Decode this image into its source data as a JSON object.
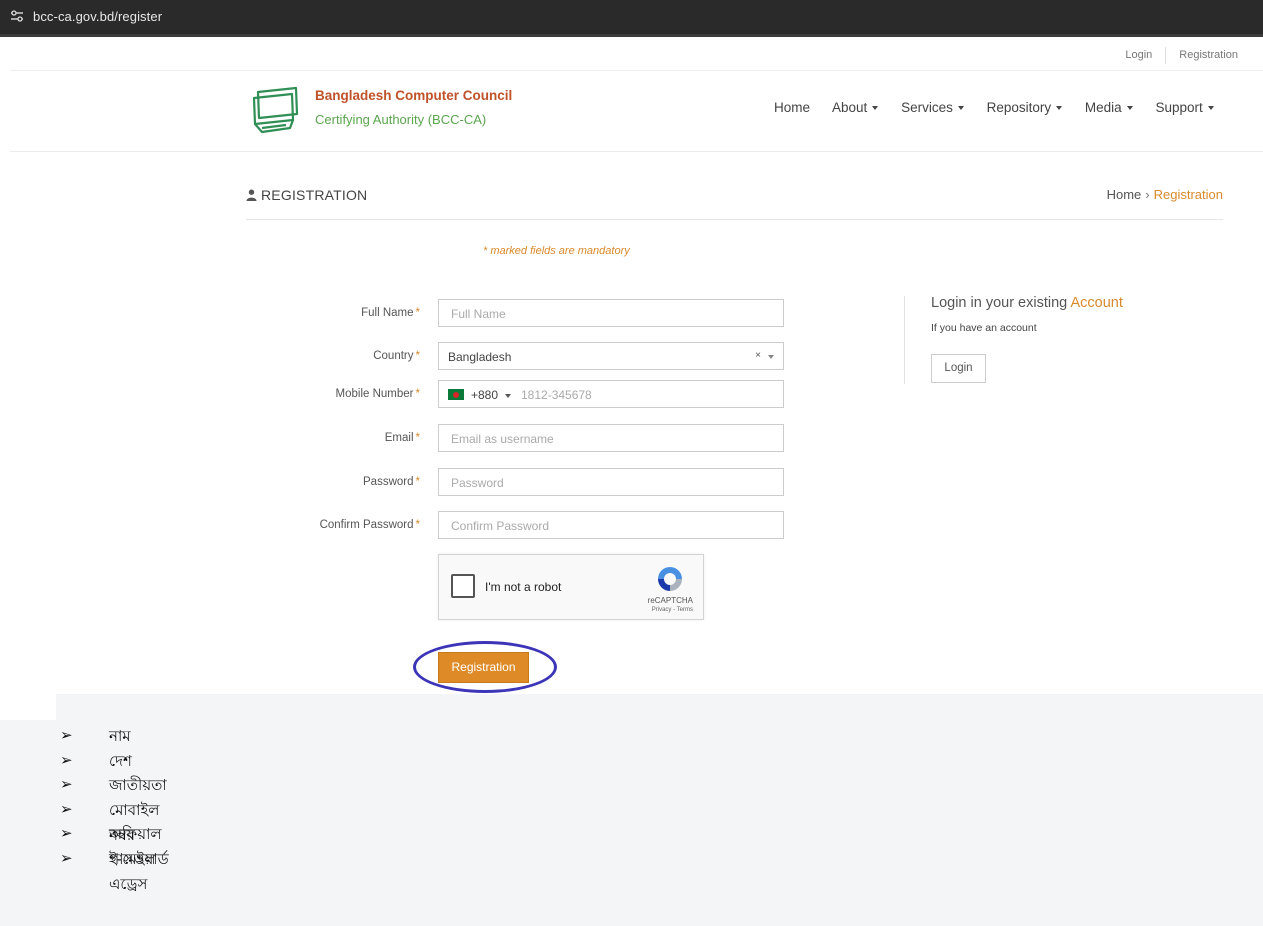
{
  "browser": {
    "url": "bcc-ca.gov.bd/register"
  },
  "toplinks": {
    "login": "Login",
    "registration": "Registration"
  },
  "brand": {
    "name": "Bangladesh Computer Council",
    "subtitle": "Certifying Authority (BCC-CA)"
  },
  "nav": {
    "home": "Home",
    "about": "About",
    "services": "Services",
    "repository": "Repository",
    "media": "Media",
    "support": "Support"
  },
  "page": {
    "title": "REGISTRATION",
    "breadcrumb_home": "Home",
    "breadcrumb_sep": "›",
    "breadcrumb_current": "Registration",
    "mandatory_note": "* marked fields are mandatory"
  },
  "form": {
    "full_name_label": "Full Name",
    "full_name_placeholder": "Full Name",
    "country_label": "Country",
    "country_value": "Bangladesh",
    "country_clear": "×",
    "mobile_label": "Mobile Number",
    "mobile_dial": "+880",
    "mobile_placeholder": "1812-345678",
    "email_label": "Email",
    "email_placeholder": "Email as username",
    "password_label": "Password",
    "password_placeholder": "Password",
    "confirm_label": "Confirm Password",
    "confirm_placeholder": "Confirm Password",
    "star": "*",
    "submit": "Registration"
  },
  "captcha": {
    "label": "I'm not a robot",
    "brand": "reCAPTCHA",
    "links": "Privacy - Terms"
  },
  "login_panel": {
    "title_prefix": "Login in your existing",
    "title_accent": "Account",
    "subtitle": "If you have an account",
    "button": "Login"
  },
  "colors": {
    "accent": "#dd8a27",
    "brand_red": "#c0522a",
    "brand_green": "#5aa64d",
    "highlight_circle": "#3d35b8"
  },
  "list": {
    "bullet": "➢",
    "items": [
      "নাম",
      "দেশ",
      "জাতীয়তা",
      "মোবাইল নম্বর",
      "অফিয়াল ই-মেইল এড্রেস",
      "পাসওয়ার্ড"
    ]
  }
}
